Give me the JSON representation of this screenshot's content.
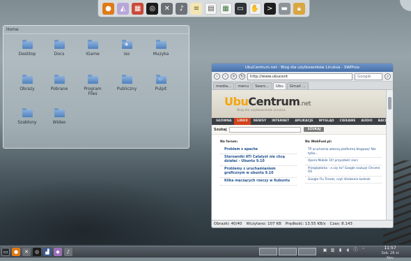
{
  "dock": {
    "icons": [
      "firefox-icon",
      "inkscape-icon",
      "calendar-icon",
      "media-player-icon",
      "tools-icon",
      "music-icon",
      "notes-icon",
      "document-icon",
      "spreadsheet-icon",
      "monitor-icon",
      "hand-icon",
      "terminal-icon",
      "storage-icon",
      "lock-icon"
    ]
  },
  "folder_window": {
    "title": "Home",
    "items": [
      {
        "label": "Desktop",
        "glyph": ""
      },
      {
        "label": "Docs",
        "glyph": ""
      },
      {
        "label": "iGame",
        "glyph": ""
      },
      {
        "label": "iso",
        "glyph": "◉"
      },
      {
        "label": "Muzyka",
        "glyph": ""
      },
      {
        "label": "Obrazy",
        "glyph": ""
      },
      {
        "label": "Pobrane",
        "glyph": ""
      },
      {
        "label": "Program Files",
        "glyph": ""
      },
      {
        "label": "Publiczny",
        "glyph": ""
      },
      {
        "label": "Pulpit",
        "glyph": "▭"
      },
      {
        "label": "Szablony",
        "glyph": ""
      },
      {
        "label": "Wideo",
        "glyph": ""
      }
    ]
  },
  "browser": {
    "title": "UbuCentrum.net - Blog dla użytkowników Linuksa - SWPhox",
    "url": "http://www.ubucent",
    "search_engine": "Google",
    "tabs": [
      "media...",
      "menu",
      "Searc...",
      "Ubu",
      "Gmail ..."
    ],
    "site": {
      "logo_ubu": "Ubu",
      "logo_centrum": "Centrum",
      "logo_net": ".net",
      "tagline": "Blog dla użytkowników Linuksa",
      "nav": [
        "GŁÓWNA",
        "LINUX",
        "NEWSY",
        "INTERNET",
        "APLIKACJE",
        "WYGLĄD",
        "CIEKAWE",
        "AUDIO",
        "BACK"
      ],
      "search_label": "Szukaj",
      "search_button": "SZUKAJ",
      "forum_header": "Na forum:",
      "forum_posts": [
        "Problem z apache",
        "Sterowniki ATI Catalyst nie chcą działać - Ubuntu 9.10",
        "Problemy z uruchamianiem graficznym w ubuntu 9.10",
        "Kilka męczących rzeczy w Kubuntu"
      ],
      "webfuel_header": "Na WebFuel.pl:",
      "webfuel_posts": [
        "TP uruchamia własną platformę blogową! Nie tylko...",
        "Opera Mobile 10! przyszłość sieci",
        "Przeglądarka - a czy to? Google szukuje Chrome OS",
        "Google Flu Trends, czyli śledzenie kontroli"
      ]
    },
    "status": {
      "images": "Obrazki: 40/40",
      "loaded": "Wczytano: 107 KB",
      "speed": "Prędkość: 13.55 KB/s",
      "time": "Czas: 8.143"
    }
  },
  "taskbar": {
    "clock_time": "11:57",
    "clock_date": "Sob. 28 st Nov"
  }
}
